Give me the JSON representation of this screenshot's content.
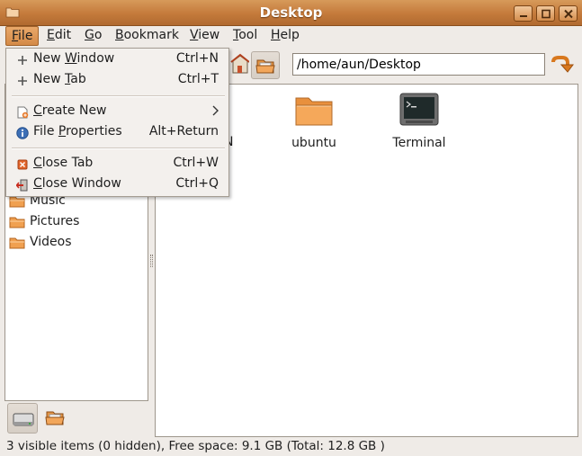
{
  "window": {
    "title": "Desktop",
    "buttons": [
      "minimize",
      "maximize",
      "close"
    ]
  },
  "menubar": {
    "items": [
      {
        "label": "File",
        "mnemonic": "F",
        "rest": "ile"
      },
      {
        "label": "Edit",
        "mnemonic": "E",
        "rest": "dit"
      },
      {
        "label": "Go",
        "mnemonic": "G",
        "rest": "o"
      },
      {
        "label": "Bookmark",
        "mnemonic": "B",
        "rest": "ookmark"
      },
      {
        "label": "View",
        "mnemonic": "V",
        "rest": "iew"
      },
      {
        "label": "Tool",
        "mnemonic": "T",
        "rest": "ool"
      },
      {
        "label": "Help",
        "mnemonic": "H",
        "rest": "elp"
      }
    ]
  },
  "file_menu": {
    "items": [
      {
        "pre": "New ",
        "mn": "W",
        "post": "indow",
        "shortcut": "Ctrl+N",
        "icon": "plus-icon"
      },
      {
        "pre": "New ",
        "mn": "T",
        "post": "ab",
        "shortcut": "Ctrl+T",
        "icon": "plus-icon"
      },
      {
        "pre": "",
        "mn": "C",
        "post": "reate New",
        "shortcut": "",
        "icon": "new-document-icon",
        "submenu": true
      },
      {
        "pre": "File ",
        "mn": "P",
        "post": "roperties",
        "shortcut": "Alt+Return",
        "icon": "info-icon"
      },
      {
        "pre": "",
        "mn": "C",
        "post": "lose Tab",
        "shortcut": "Ctrl+W",
        "icon": "close-tab-icon"
      },
      {
        "pre": "",
        "mn": "C",
        "post": "lose Window",
        "shortcut": "Ctrl+Q",
        "icon": "exit-icon"
      }
    ]
  },
  "toolbar": {
    "path": "/home/aun/Desktop"
  },
  "sidepane": {
    "items": [
      {
        "label": "Music",
        "icon": "folder-icon"
      },
      {
        "label": "Pictures",
        "icon": "folder-icon"
      },
      {
        "label": "Videos",
        "icon": "folder-icon"
      }
    ]
  },
  "main": {
    "partial_label": "N",
    "files": [
      {
        "label": "ubuntu",
        "icon": "folder-icon"
      },
      {
        "label": "Terminal",
        "icon": "terminal-icon"
      }
    ]
  },
  "statusbar": {
    "text": "3 visible items (0 hidden), Free space: 9.1 GB (Total: 12.8 GB )"
  },
  "colors": {
    "titlebar": "#c47a3b",
    "menu_highlight": "#d48a47",
    "folder": "#f0a050"
  }
}
